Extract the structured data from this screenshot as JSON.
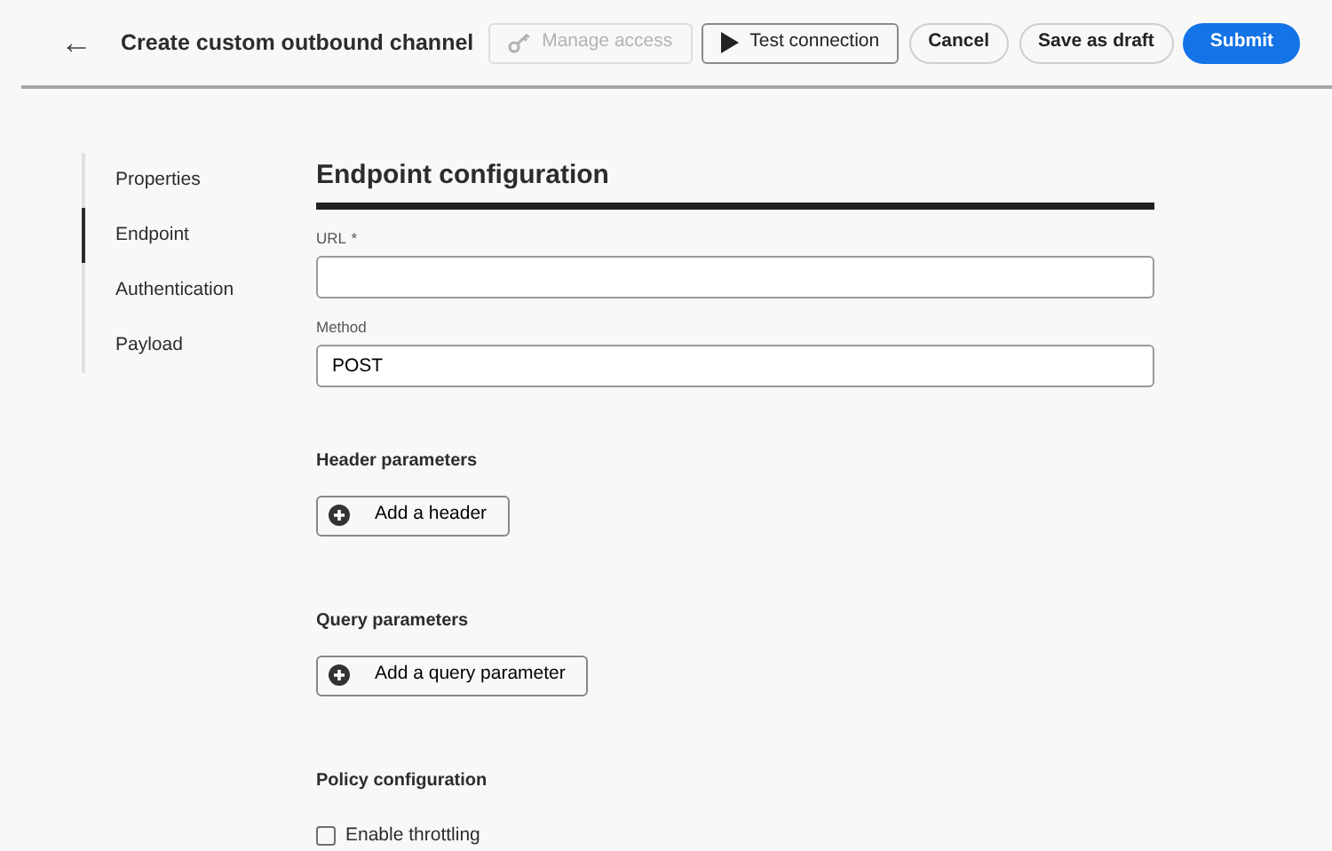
{
  "header": {
    "back_icon": "←",
    "title": "Create custom outbound channel"
  },
  "actions": [
    {
      "label": "Manage access",
      "kind": "key",
      "disabled": true
    },
    {
      "label": "Test connection",
      "kind": "play",
      "disabled": false
    },
    {
      "label": "Cancel",
      "kind": "secondary",
      "disabled": false
    },
    {
      "label": "Save as draft",
      "kind": "secondary",
      "disabled": false
    },
    {
      "label": "Submit",
      "kind": "primary",
      "disabled": false
    }
  ],
  "sidebar": {
    "items": [
      {
        "label": "Properties",
        "selected": false
      },
      {
        "label": "Endpoint",
        "selected": true
      },
      {
        "label": "Authentication",
        "selected": false
      },
      {
        "label": "Payload",
        "selected": false
      }
    ]
  },
  "section": {
    "title": "Endpoint configuration",
    "fields": [
      {
        "label": "URL",
        "required_mark": "*"
      },
      {
        "label": "Method",
        "value": "POST"
      }
    ],
    "groups": [
      {
        "title": "Header parameters",
        "button": "Add a header"
      },
      {
        "title": "Query parameters",
        "button": "Add a query parameter"
      }
    ],
    "policy": {
      "title": "Policy configuration",
      "checkbox": {
        "label": "Enable throttling",
        "checked": false
      }
    }
  }
}
